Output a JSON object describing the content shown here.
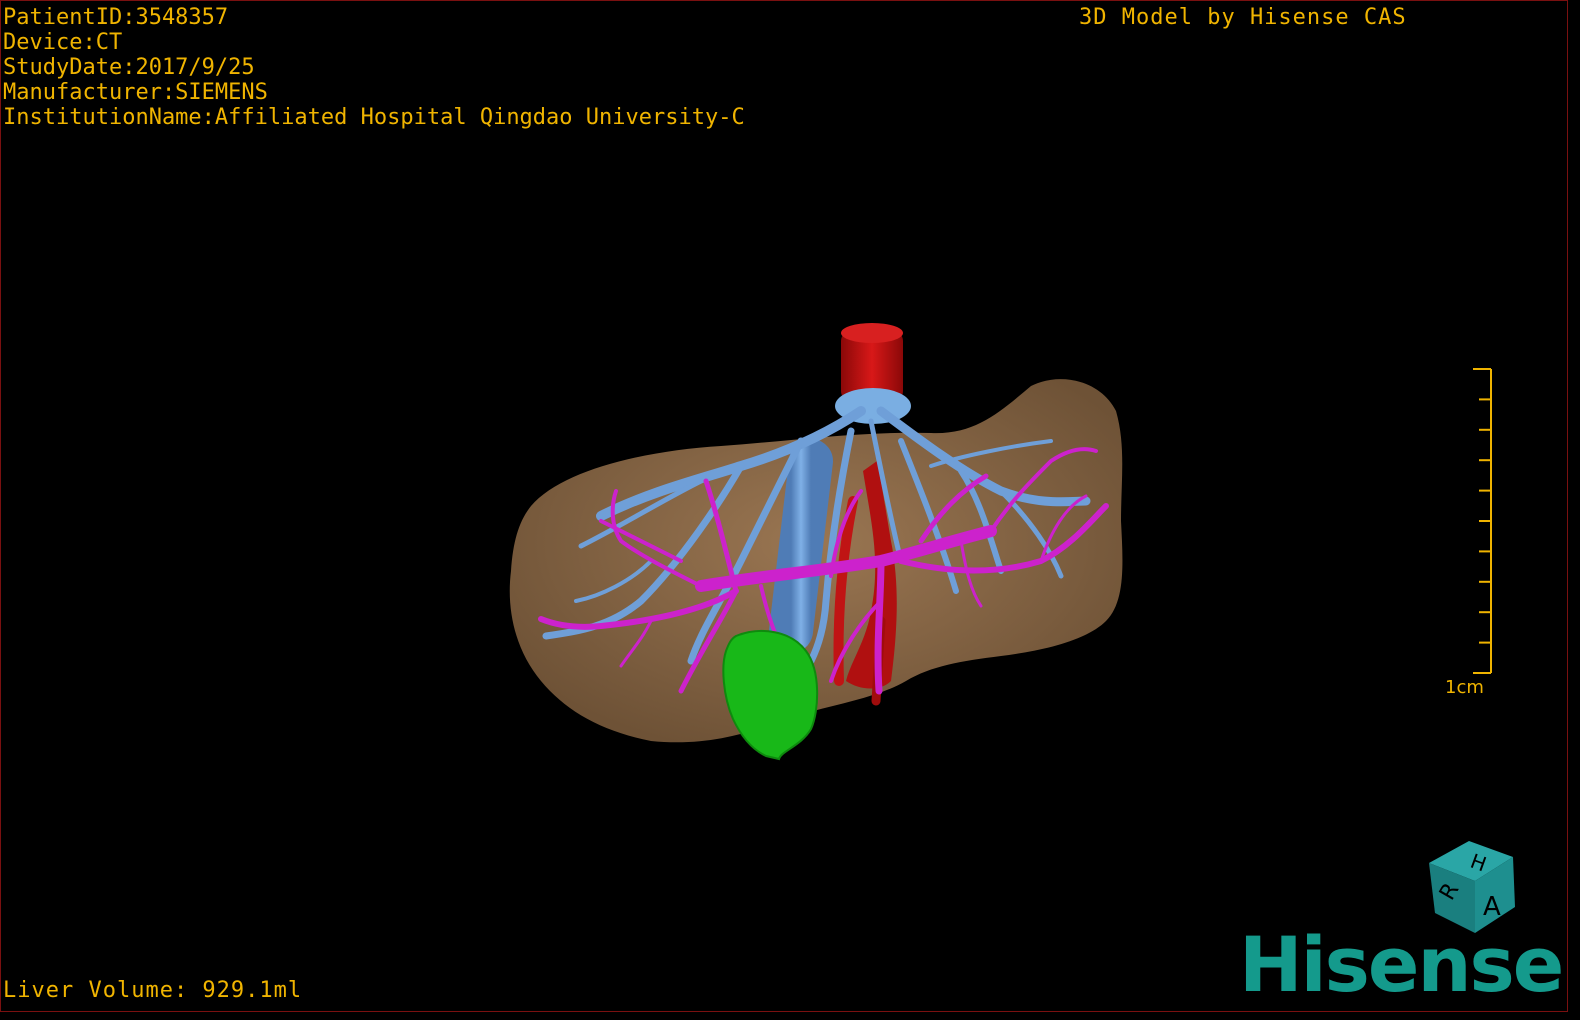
{
  "info": {
    "patient_id": "PatientID:3548357",
    "device": "Device:CT",
    "study_date": "StudyDate:2017/9/25",
    "manufacturer": "Manufacturer:SIEMENS",
    "institution": "InstitutionName:Affiliated Hospital Qingdao University-C"
  },
  "credit": "3D Model by Hisense CAS",
  "liver_volume": "Liver Volume: 929.1ml",
  "scale": {
    "label": "1cm",
    "ticks": 10
  },
  "cube": {
    "face_top": "H",
    "face_left": "R",
    "face_right": "A"
  },
  "brand": "Hisense",
  "colors": {
    "text": "#f0b400",
    "liver": "#8c6a48",
    "hepatic_vein": "#6f9fd8",
    "portal_vein": "#cc22cc",
    "artery_ivc": "#c01010",
    "gallbladder": "#18b818",
    "cube": "#1e8f8f",
    "brand": "#149a8c"
  }
}
